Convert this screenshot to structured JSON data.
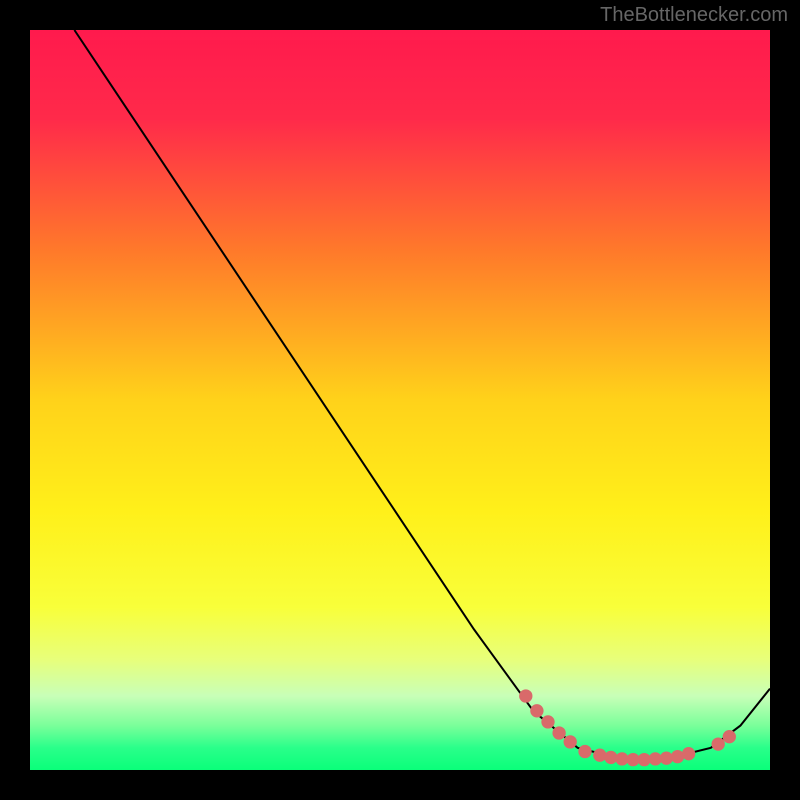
{
  "watermark": "TheBottlenecker.com",
  "chart_data": {
    "type": "line",
    "title": "",
    "xlabel": "",
    "ylabel": "",
    "xlim": [
      0,
      100
    ],
    "ylim": [
      0,
      100
    ],
    "gradient_stops": [
      {
        "offset": 0,
        "color": "#ff1a4d"
      },
      {
        "offset": 12,
        "color": "#ff2a4a"
      },
      {
        "offset": 30,
        "color": "#ff7a2a"
      },
      {
        "offset": 50,
        "color": "#ffd21a"
      },
      {
        "offset": 65,
        "color": "#fff01a"
      },
      {
        "offset": 78,
        "color": "#f8ff3a"
      },
      {
        "offset": 85,
        "color": "#e8ff7a"
      },
      {
        "offset": 90,
        "color": "#c8ffb8"
      },
      {
        "offset": 94,
        "color": "#7aff9a"
      },
      {
        "offset": 97,
        "color": "#2aff8a"
      },
      {
        "offset": 100,
        "color": "#0aff7a"
      }
    ],
    "series": [
      {
        "name": "curve",
        "color": "#000000",
        "points": [
          {
            "x": 6,
            "y": 100
          },
          {
            "x": 10,
            "y": 94
          },
          {
            "x": 14,
            "y": 88
          },
          {
            "x": 20,
            "y": 79
          },
          {
            "x": 30,
            "y": 64
          },
          {
            "x": 40,
            "y": 49
          },
          {
            "x": 50,
            "y": 34
          },
          {
            "x": 60,
            "y": 19
          },
          {
            "x": 68,
            "y": 8
          },
          {
            "x": 74,
            "y": 3
          },
          {
            "x": 80,
            "y": 1.5
          },
          {
            "x": 86,
            "y": 1.5
          },
          {
            "x": 92,
            "y": 3
          },
          {
            "x": 96,
            "y": 6
          },
          {
            "x": 100,
            "y": 11
          }
        ]
      }
    ],
    "markers": [
      {
        "x": 67,
        "y": 10,
        "color": "#d96a6a"
      },
      {
        "x": 68.5,
        "y": 8,
        "color": "#d96a6a"
      },
      {
        "x": 70,
        "y": 6.5,
        "color": "#d96a6a"
      },
      {
        "x": 71.5,
        "y": 5,
        "color": "#d96a6a"
      },
      {
        "x": 73,
        "y": 3.8,
        "color": "#d96a6a"
      },
      {
        "x": 75,
        "y": 2.5,
        "color": "#d96a6a"
      },
      {
        "x": 77,
        "y": 2,
        "color": "#d96a6a"
      },
      {
        "x": 78.5,
        "y": 1.7,
        "color": "#d96a6a"
      },
      {
        "x": 80,
        "y": 1.5,
        "color": "#d96a6a"
      },
      {
        "x": 81.5,
        "y": 1.4,
        "color": "#d96a6a"
      },
      {
        "x": 83,
        "y": 1.4,
        "color": "#d96a6a"
      },
      {
        "x": 84.5,
        "y": 1.5,
        "color": "#d96a6a"
      },
      {
        "x": 86,
        "y": 1.6,
        "color": "#d96a6a"
      },
      {
        "x": 87.5,
        "y": 1.8,
        "color": "#d96a6a"
      },
      {
        "x": 89,
        "y": 2.2,
        "color": "#d96a6a"
      },
      {
        "x": 93,
        "y": 3.5,
        "color": "#d96a6a"
      },
      {
        "x": 94.5,
        "y": 4.5,
        "color": "#d96a6a"
      }
    ]
  }
}
